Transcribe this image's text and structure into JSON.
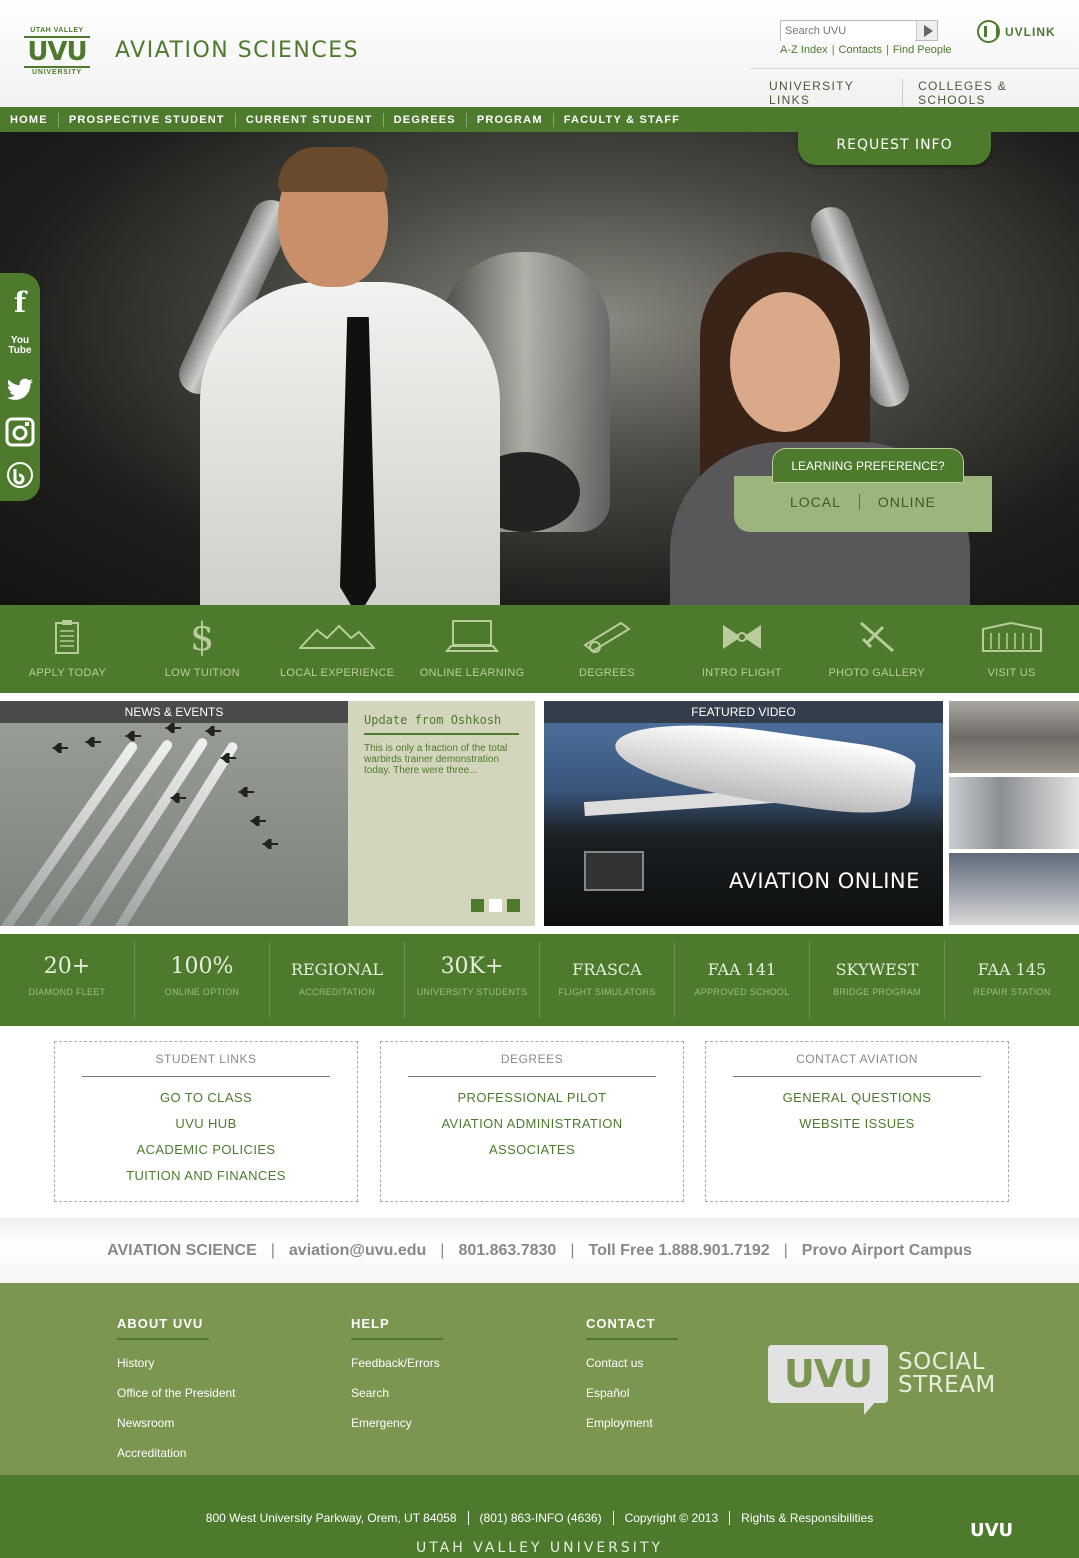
{
  "logo": {
    "top": "UTAH VALLEY",
    "mid": "UVU",
    "bottom": "UNIVERSITY"
  },
  "site_title": "AVIATION SCIENCES",
  "search": {
    "placeholder": "Search UVU"
  },
  "quick_links": [
    "A-Z Index",
    "Contacts",
    "Find People"
  ],
  "uvlink": "UVLINK",
  "top_links": [
    "UNIVERSITY LINKS",
    "COLLEGES & SCHOOLS"
  ],
  "nav": [
    "HOME",
    "PROSPECTIVE STUDENT",
    "CURRENT STUDENT",
    "DEGREES",
    "PROGRAM",
    "FACULTY & STAFF"
  ],
  "hero": {
    "request_info": "REQUEST INFO",
    "learning_pref": "LEARNING PREFERENCE?",
    "options": [
      "LOCAL",
      "ONLINE"
    ]
  },
  "social": [
    "facebook",
    "youtube",
    "twitter",
    "instagram",
    "blog"
  ],
  "quick_bar": [
    {
      "label": "APPLY TODAY",
      "icon": "clipboard-icon"
    },
    {
      "label": "LOW TUITION",
      "icon": "dollar-icon"
    },
    {
      "label": "LOCAL EXPERIENCE",
      "icon": "mountains-icon"
    },
    {
      "label": "ONLINE LEARNING",
      "icon": "laptop-icon"
    },
    {
      "label": "DEGREES",
      "icon": "diploma-icon"
    },
    {
      "label": "INTRO FLIGHT",
      "icon": "propeller-icon"
    },
    {
      "label": "PHOTO GALLERY",
      "icon": "plane-icon"
    },
    {
      "label": "VISIT US",
      "icon": "building-icon"
    }
  ],
  "news": {
    "header": "NEWS & EVENTS",
    "title": "Update from Oshkosh",
    "body": "This is only a fraction of the total warbirds trainer demonstration today. There were three..."
  },
  "video": {
    "header": "FEATURED VIDEO",
    "title": "AVIATION ONLINE"
  },
  "stats": [
    {
      "value": "20+",
      "sub": "DIAMOND FLEET"
    },
    {
      "value": "100%",
      "sub": "ONLINE OPTION"
    },
    {
      "value": "REGIONAL",
      "sub": "ACCREDITATION"
    },
    {
      "value": "30K+",
      "sub": "UNIVERSITY STUDENTS"
    },
    {
      "value": "FRASCA",
      "sub": "FLIGHT SIMULATORS"
    },
    {
      "value": "FAA 141",
      "sub": "APPROVED SCHOOL"
    },
    {
      "value": "SKYWEST",
      "sub": "BRIDGE PROGRAM"
    },
    {
      "value": "FAA 145",
      "sub": "REPAIR STATION"
    }
  ],
  "link_boxes": [
    {
      "title": "STUDENT LINKS",
      "items": [
        "GO TO CLASS",
        "UVU HUB",
        "ACADEMIC POLICIES",
        "TUITION AND FINANCES"
      ]
    },
    {
      "title": "DEGREES",
      "items": [
        "PROFESSIONAL PILOT",
        "AVIATION ADMINISTRATION",
        "ASSOCIATES"
      ]
    },
    {
      "title": "CONTACT AVIATION",
      "items": [
        "GENERAL QUESTIONS",
        "WEBSITE ISSUES"
      ]
    }
  ],
  "contact_strip": [
    "AVIATION SCIENCE",
    "aviation@uvu.edu",
    "801.863.7830",
    "Toll Free 1.888.901.7192",
    "Provo Airport Campus"
  ],
  "footer": {
    "cols": [
      {
        "heading": "ABOUT UVU",
        "links": [
          "History",
          "Office of the President",
          "Newsroom",
          "Accreditation"
        ]
      },
      {
        "heading": "HELP",
        "links": [
          "Feedback/Errors",
          "Search",
          "Emergency"
        ]
      },
      {
        "heading": "CONTACT",
        "links": [
          "Contact us",
          "Español",
          "Employment"
        ]
      }
    ],
    "social_stream": {
      "logo": "UVU",
      "line1": "SOCIAL",
      "line2": "STREAM"
    }
  },
  "bottom": {
    "links": [
      "800 West University Parkway, Orem, UT 84058",
      "(801) 863-INFO (4636)",
      "Copyright © 2013",
      "Rights & Responsibilities"
    ],
    "uvu": "UVU",
    "name": "UTAH VALLEY UNIVERSITY"
  },
  "colors": {
    "brand_green": "#4e7a2e",
    "footer_green": "#7a9650",
    "light_green": "#9cb57c"
  }
}
